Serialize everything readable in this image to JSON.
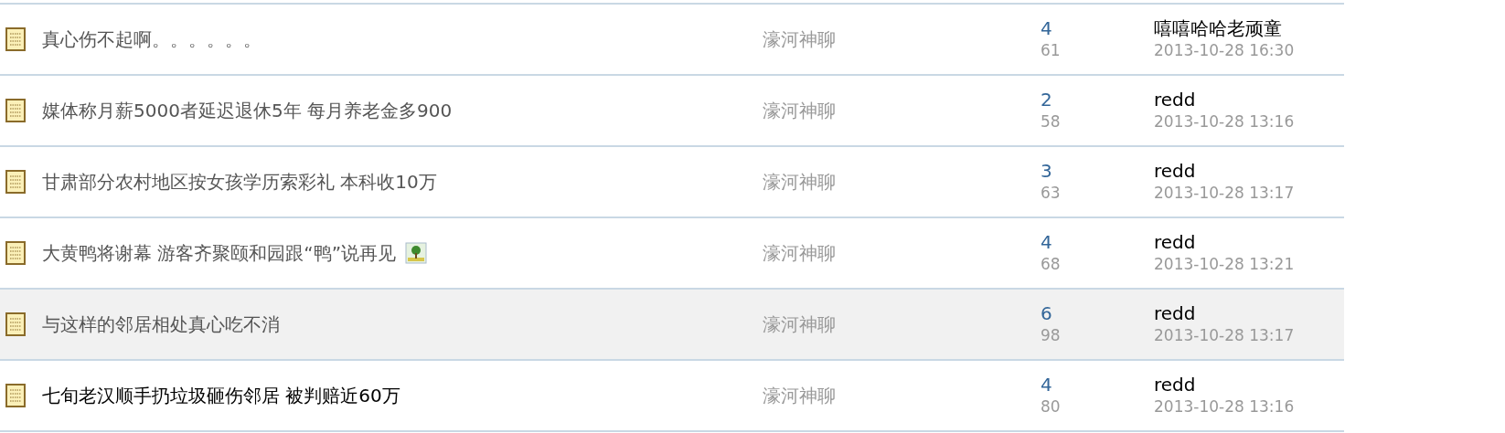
{
  "threads": [
    {
      "title": "真心伤不起啊。。。。。。",
      "has_image": false,
      "read": true,
      "highlighted": false,
      "forum": "濠河神聊",
      "replies": "4",
      "views": "61",
      "last_poster": "嘻嘻哈哈老顽童",
      "last_time": "2013-10-28 16:30"
    },
    {
      "title": "媒体称月薪5000者延迟退休5年 每月养老金多900",
      "has_image": false,
      "read": true,
      "highlighted": false,
      "forum": "濠河神聊",
      "replies": "2",
      "views": "58",
      "last_poster": "redd",
      "last_time": "2013-10-28 13:16"
    },
    {
      "title": "甘肃部分农村地区按女孩学历索彩礼 本科收10万",
      "has_image": false,
      "read": true,
      "highlighted": false,
      "forum": "濠河神聊",
      "replies": "3",
      "views": "63",
      "last_poster": "redd",
      "last_time": "2013-10-28 13:17"
    },
    {
      "title": "大黄鸭将谢幕 游客齐聚颐和园跟“鸭”说再见",
      "has_image": true,
      "read": true,
      "highlighted": false,
      "forum": "濠河神聊",
      "replies": "4",
      "views": "68",
      "last_poster": "redd",
      "last_time": "2013-10-28 13:21"
    },
    {
      "title": "与这样的邻居相处真心吃不消",
      "has_image": false,
      "read": true,
      "highlighted": true,
      "forum": "濠河神聊",
      "replies": "6",
      "views": "98",
      "last_poster": "redd",
      "last_time": "2013-10-28 13:17"
    },
    {
      "title": "七旬老汉顺手扔垃圾砸伤邻居 被判赔近60万",
      "has_image": false,
      "read": false,
      "highlighted": false,
      "forum": "濠河神聊",
      "replies": "4",
      "views": "80",
      "last_poster": "redd",
      "last_time": "2013-10-28 13:16"
    }
  ]
}
